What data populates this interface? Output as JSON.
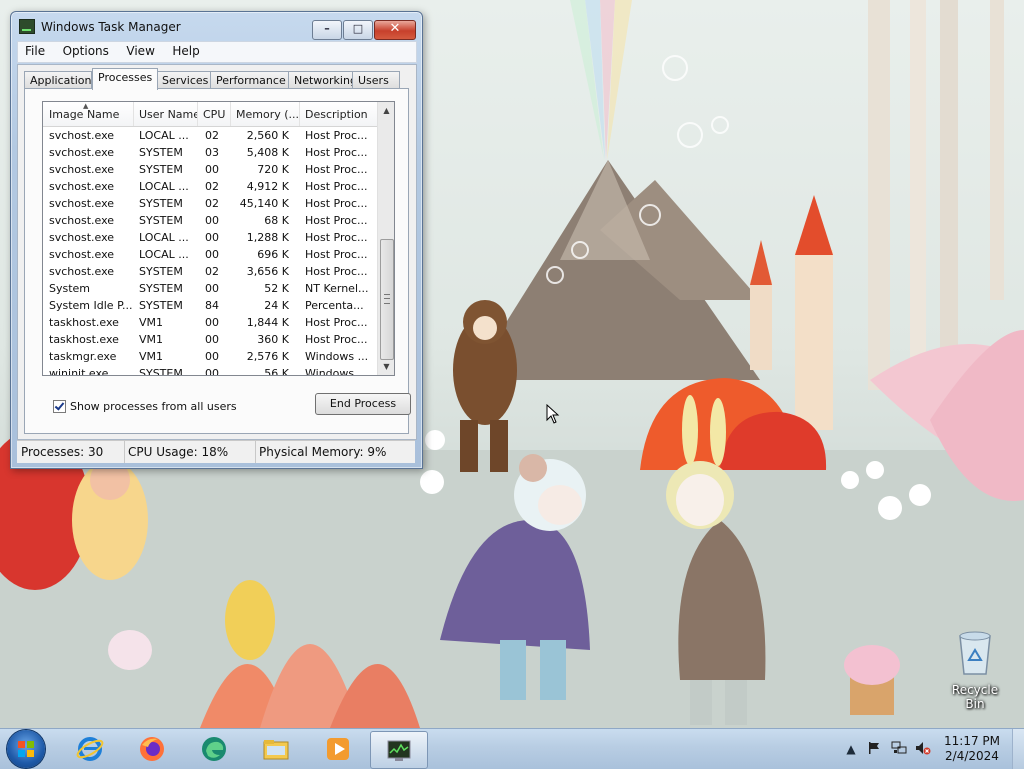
{
  "task_manager": {
    "title": "Windows Task Manager",
    "caption_buttons": {
      "minimize": "–",
      "maximize": "□",
      "close": "✕"
    },
    "menu": [
      "File",
      "Options",
      "View",
      "Help"
    ],
    "tabs": [
      "Applications",
      "Processes",
      "Services",
      "Performance",
      "Networking",
      "Users"
    ],
    "active_tab": "Processes",
    "columns": [
      "Image Name",
      "User Name",
      "CPU",
      "Memory (...",
      "Description"
    ],
    "processes": [
      {
        "image": "svchost.exe",
        "user": "LOCAL ...",
        "cpu": "02",
        "memory": "2,560 K",
        "desc": "Host Proc..."
      },
      {
        "image": "svchost.exe",
        "user": "SYSTEM",
        "cpu": "03",
        "memory": "5,408 K",
        "desc": "Host Proc..."
      },
      {
        "image": "svchost.exe",
        "user": "SYSTEM",
        "cpu": "00",
        "memory": "720 K",
        "desc": "Host Proc..."
      },
      {
        "image": "svchost.exe",
        "user": "LOCAL ...",
        "cpu": "02",
        "memory": "4,912 K",
        "desc": "Host Proc..."
      },
      {
        "image": "svchost.exe",
        "user": "SYSTEM",
        "cpu": "02",
        "memory": "45,140 K",
        "desc": "Host Proc..."
      },
      {
        "image": "svchost.exe",
        "user": "SYSTEM",
        "cpu": "00",
        "memory": "68 K",
        "desc": "Host Proc..."
      },
      {
        "image": "svchost.exe",
        "user": "LOCAL ...",
        "cpu": "00",
        "memory": "1,288 K",
        "desc": "Host Proc..."
      },
      {
        "image": "svchost.exe",
        "user": "LOCAL ...",
        "cpu": "00",
        "memory": "696 K",
        "desc": "Host Proc..."
      },
      {
        "image": "svchost.exe",
        "user": "SYSTEM",
        "cpu": "02",
        "memory": "3,656 K",
        "desc": "Host Proc..."
      },
      {
        "image": "System",
        "user": "SYSTEM",
        "cpu": "00",
        "memory": "52 K",
        "desc": "NT Kernel..."
      },
      {
        "image": "System Idle P...",
        "user": "SYSTEM",
        "cpu": "84",
        "memory": "24 K",
        "desc": "Percenta..."
      },
      {
        "image": "taskhost.exe",
        "user": "VM1",
        "cpu": "00",
        "memory": "1,844 K",
        "desc": "Host Proc..."
      },
      {
        "image": "taskhost.exe",
        "user": "VM1",
        "cpu": "00",
        "memory": "360 K",
        "desc": "Host Proc..."
      },
      {
        "image": "taskmgr.exe",
        "user": "VM1",
        "cpu": "00",
        "memory": "2,576 K",
        "desc": "Windows ..."
      },
      {
        "image": "wininit.exe",
        "user": "SYSTEM",
        "cpu": "00",
        "memory": "56 K",
        "desc": "Windows ..."
      }
    ],
    "show_all_label": "Show processes from all users",
    "show_all_checked": true,
    "end_process_label": "End Process",
    "status": {
      "processes": "Processes: 30",
      "cpu": "CPU Usage: 18%",
      "memory": "Physical Memory: 9%"
    }
  },
  "desktop": {
    "icons": [
      {
        "label": "Recycle Bin",
        "icon": "recycle-bin-icon"
      }
    ]
  },
  "taskbar": {
    "start_icon": "windows-start-icon",
    "pinned": [
      "internet-explorer-icon",
      "firefox-icon",
      "edge-icon",
      "file-explorer-icon",
      "media-player-icon",
      "task-manager-icon"
    ],
    "active_app": "task-manager-icon",
    "tray_icons": [
      "show-hidden-icons-icon",
      "action-center-flag-icon",
      "network-icon",
      "volume-muted-icon"
    ],
    "clock_time": "11:17 PM",
    "clock_date": "2/4/2024"
  },
  "colors": {
    "taskbar": "#b8cde3",
    "window_frame": "#b3c9e2",
    "close_button": "#c7402c"
  }
}
